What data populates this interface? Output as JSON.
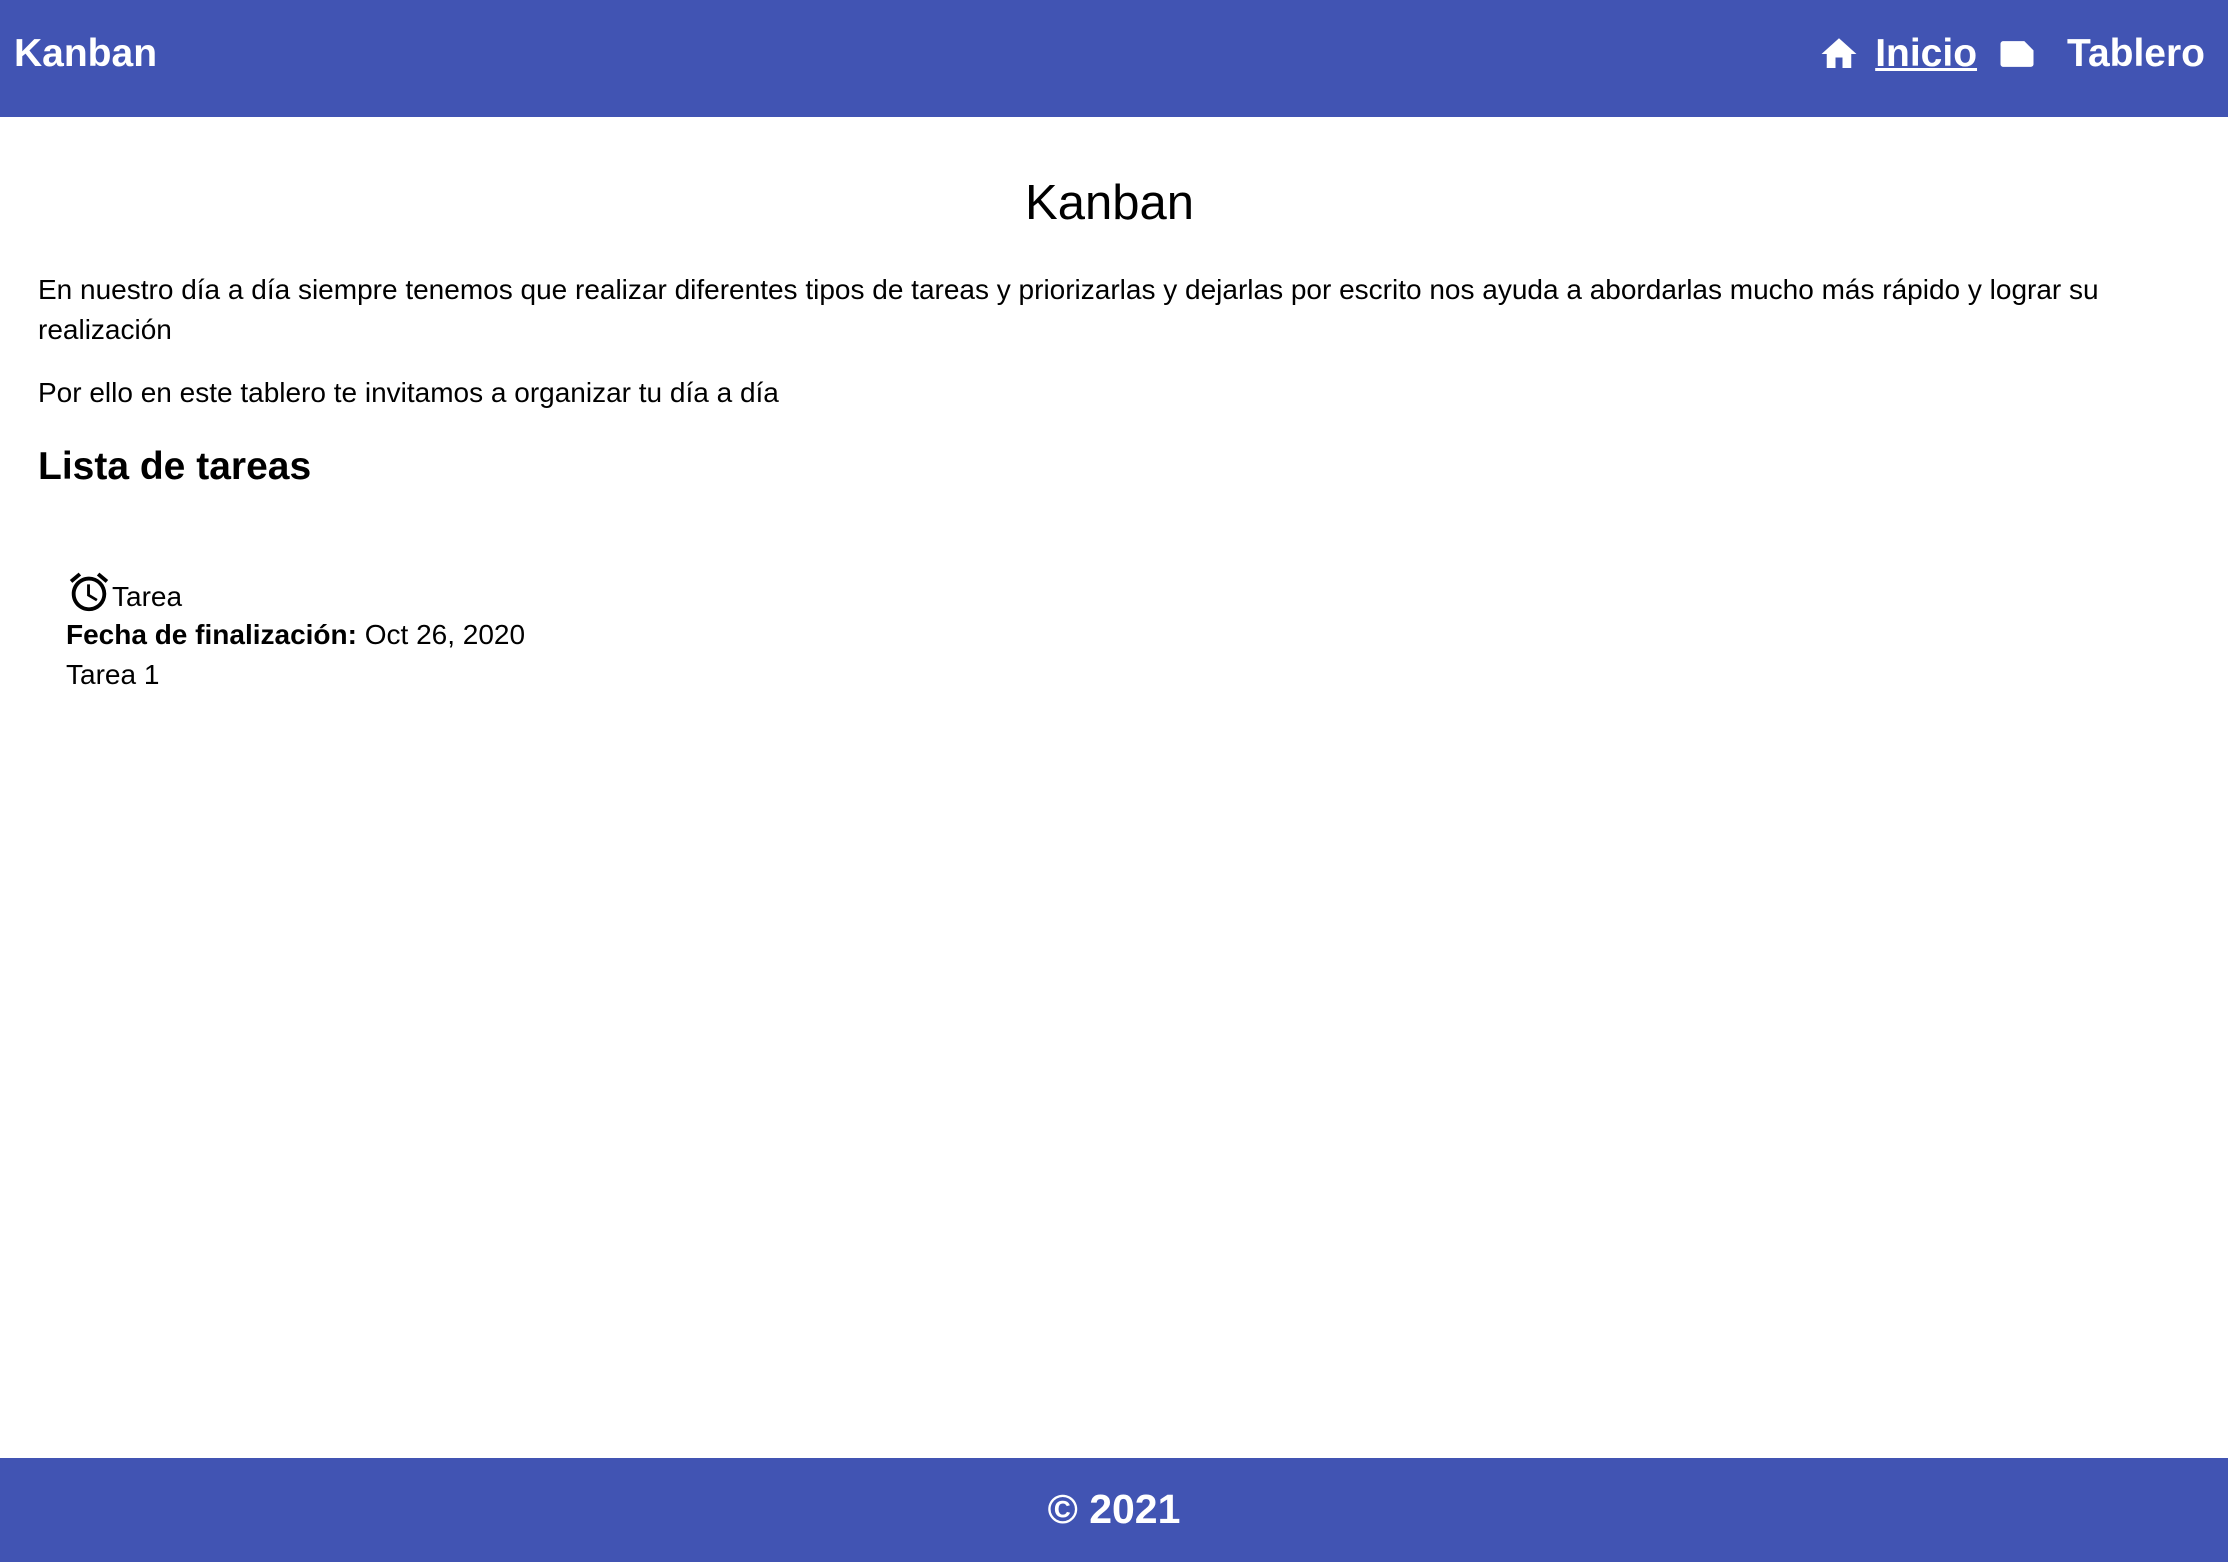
{
  "navbar": {
    "brand": "Kanban",
    "links": {
      "inicio": {
        "label": "Inicio",
        "icon": "home-icon"
      },
      "tablero": {
        "label": "Tablero",
        "icon": "label-icon"
      }
    },
    "background_color": "#4154b3"
  },
  "main": {
    "title": "Kanban",
    "paragraph_1": "En nuestro día a día siempre tenemos que realizar diferentes tipos de tareas y priorizarlas y dejarlas por escrito nos ayuda a abordarlas mucho más rápido y lograr su realización",
    "paragraph_2": "Por ello en este tablero te invitamos a organizar tu día a día",
    "section_title": "Lista de tareas",
    "tasks": [
      {
        "icon": "alarm-icon",
        "type": "Tarea",
        "due_label": "Fecha de finalización:",
        "due_date": "Oct 26, 2020",
        "name": "Tarea 1"
      }
    ]
  },
  "footer": {
    "text": "© 2021"
  }
}
